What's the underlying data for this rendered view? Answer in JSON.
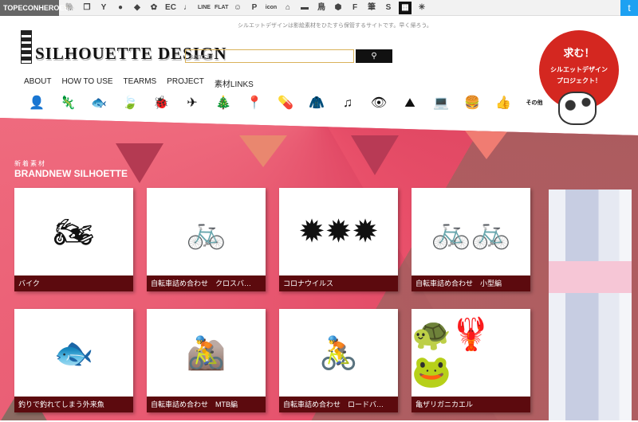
{
  "topbar": {
    "brand": "TOPECONHEROES",
    "icons": [
      "animal-icon",
      "copy-icon",
      "person-icon",
      "speech-icon",
      "shape-icon",
      "flower-icon",
      "EC",
      "♩",
      "LINE",
      "FLAT",
      "smile-icon",
      "P",
      "icon",
      "house-icon",
      "sofa-icon",
      "bird-icon",
      "ball-icon",
      "F",
      "筆",
      "S",
      "grid-icon",
      "star-icon"
    ],
    "twitter": "twitter-icon"
  },
  "header": {
    "tagline": "シルエットデザインは影絵素材をひたすら保管するサイトです。早く帰ろう。",
    "logo": "SILHOUETTE DESIGN",
    "search_placeholder": "search"
  },
  "nav": [
    "ABOUT",
    "HOW TO USE",
    "TEARMS",
    "PROJECT",
    "素材LINKS"
  ],
  "categories": [
    "person-icon",
    "lizard-icon",
    "fish-icon",
    "leaf-icon",
    "bug-icon",
    "airplane-icon",
    "tree-icon",
    "map-pin-icon",
    "pill-icon",
    "jacket-icon",
    "music-icon",
    "eye-icon",
    "mountain-icon",
    "laptop-icon",
    "burger-icon",
    "hand-icon",
    "その他"
  ],
  "promo": {
    "title": "求む！",
    "line1": "シルエットデザイン",
    "line2": "プロジェクト！"
  },
  "section": {
    "jp": "新着素材",
    "en": "BRANDNEW SILHOETTE"
  },
  "cards": [
    {
      "caption": "バイク",
      "icon": "🏍"
    },
    {
      "caption": "自転車詰め合わせ　クロスバ…",
      "icon": "🚲"
    },
    {
      "caption": "コロナウイルス",
      "icon": "✹✹✹"
    },
    {
      "caption": "自転車詰め合わせ　小型編",
      "icon": "🚲🚲"
    },
    {
      "caption": "釣りで釣れてしまう外来魚",
      "icon": "🐟"
    },
    {
      "caption": "自転車詰め合わせ　MTB編",
      "icon": "🚵"
    },
    {
      "caption": "自転車詰め合わせ　ロードバ…",
      "icon": "🚴"
    },
    {
      "caption": "亀ザリガニカエル",
      "icon": "🐢🦞🐸"
    }
  ],
  "colors": {
    "accent": "#e74f6b",
    "caption_bg": "#5c0a0e",
    "promo": "#d42720"
  }
}
